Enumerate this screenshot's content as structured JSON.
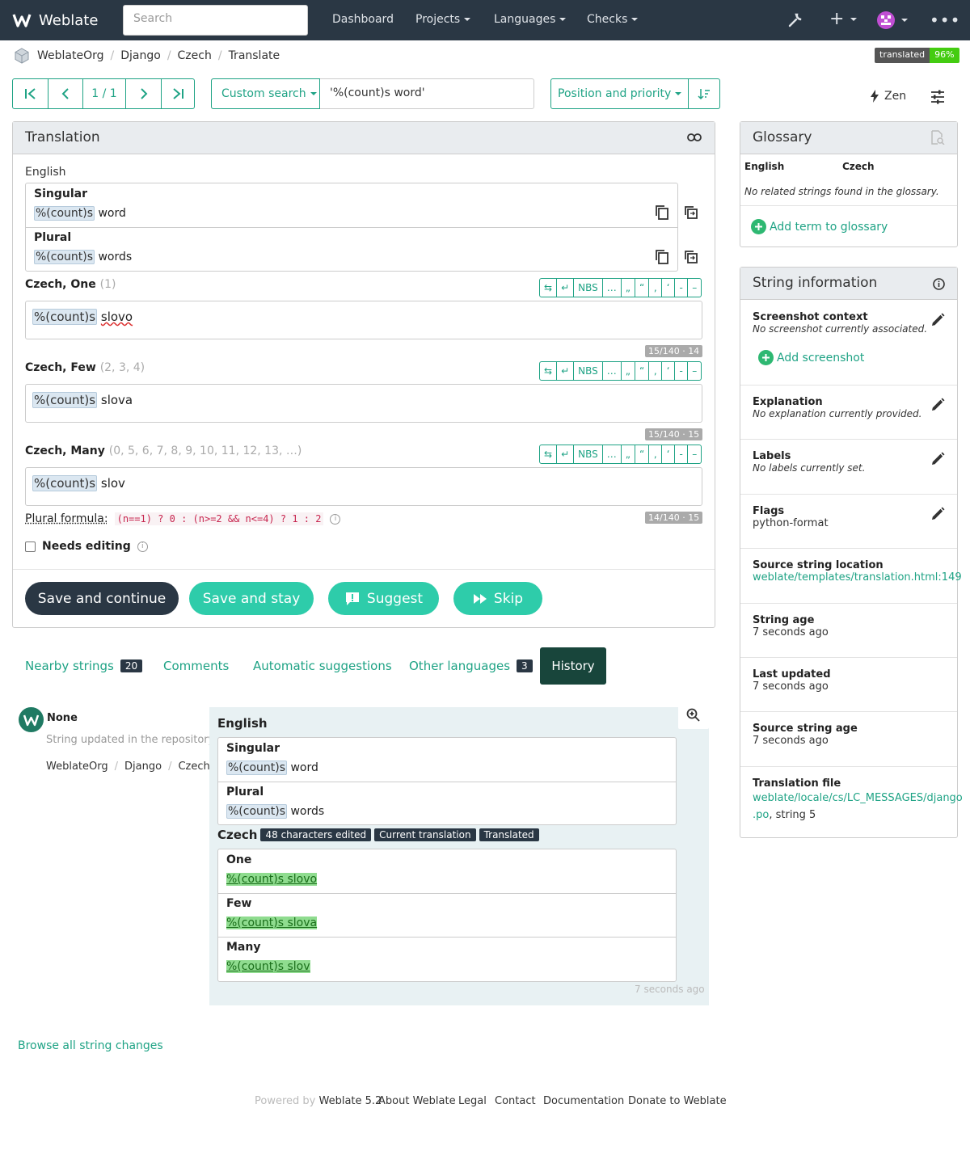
{
  "navbar": {
    "brand": "Weblate",
    "search_placeholder": "Search",
    "links": [
      "Dashboard",
      "Projects",
      "Languages",
      "Checks"
    ]
  },
  "breadcrumb": [
    "WeblateOrg",
    "Django",
    "Czech",
    "Translate"
  ],
  "translated_badge": {
    "label": "translated",
    "value": "96%"
  },
  "toolbar": {
    "position": "1 / 1",
    "search_type": "Custom search",
    "query": "'%(count)s word'",
    "sort": "Position and priority",
    "zen": "Zen"
  },
  "translation": {
    "title": "Translation",
    "source_lang": "English",
    "singular_label": "Singular",
    "singular_text": "word",
    "plural_label": "Plural",
    "plural_text": "words",
    "placeholder": "%(count)s",
    "forms": [
      {
        "name": "Czech, One",
        "nums": "(1)",
        "text": "slovo",
        "counter": "15/140 · 14"
      },
      {
        "name": "Czech, Few",
        "nums": "(2, 3, 4)",
        "text": "slova",
        "counter": "15/140 · 15"
      },
      {
        "name": "Czech, Many",
        "nums": "(0, 5, 6, 7, 8, 9, 10, 11, 12, 13, …)",
        "text": "slov",
        "counter": "14/140 · 15"
      }
    ],
    "charbar": [
      "↵",
      "NBS",
      "…",
      "„",
      "“",
      "‚",
      "‘",
      "-",
      "–"
    ],
    "plural_formula_label": "Plural formula:",
    "plural_formula": "(n==1) ? 0 : (n>=2 && n<=4) ? 1 : 2",
    "needs_editing": "Needs editing",
    "buttons": {
      "save_continue": "Save and continue",
      "save_stay": "Save and stay",
      "suggest": "Suggest",
      "skip": "Skip"
    }
  },
  "tabs": [
    {
      "label": "Nearby strings",
      "count": "20"
    },
    {
      "label": "Comments"
    },
    {
      "label": "Automatic suggestions"
    },
    {
      "label": "Other languages",
      "count": "3"
    },
    {
      "label": "History"
    }
  ],
  "history": {
    "user": "None",
    "action": "String updated in the repository",
    "path": [
      "WeblateOrg",
      "Django",
      "Czech"
    ],
    "english": "English",
    "singular": "Singular",
    "singular_text": "word",
    "plural": "Plural",
    "plural_text": "words",
    "placeholder": "%(count)s",
    "czech": "Czech",
    "tags": [
      "48 characters edited",
      "Current translation",
      "Translated"
    ],
    "forms": [
      {
        "label": "One",
        "text": "%(count)s slovo"
      },
      {
        "label": "Few",
        "text": "%(count)s slova"
      },
      {
        "label": "Many",
        "text": "%(count)s slov"
      }
    ],
    "age": "7 seconds ago"
  },
  "browse_changes": "Browse all string changes",
  "glossary": {
    "title": "Glossary",
    "col_source": "English",
    "col_target": "Czech",
    "empty": "No related strings found in the glossary.",
    "add": "Add term to glossary"
  },
  "string_info": {
    "title": "String information",
    "screenshot_title": "Screenshot context",
    "screenshot_value": "No screenshot currently associated.",
    "add_screenshot": "Add screenshot",
    "explanation_title": "Explanation",
    "explanation_value": "No explanation currently provided.",
    "labels_title": "Labels",
    "labels_value": "No labels currently set.",
    "flags_title": "Flags",
    "flags_value": "python-format",
    "location_title": "Source string location",
    "location_value": "weblate/templates/translation.html:149",
    "age_title": "String age",
    "age_value": "7 seconds ago",
    "updated_title": "Last updated",
    "updated_value": "7 seconds ago",
    "source_age_title": "Source string age",
    "source_age_value": "7 seconds ago",
    "file_title": "Translation file",
    "file_line1": "weblate/locale/cs/LC_MESSAGES/django",
    "file_line2": ".po",
    "file_suffix": ", string 5"
  },
  "footer": {
    "powered": "Powered by",
    "version": "Weblate 5.2",
    "links": [
      "About Weblate",
      "Legal",
      "Contact",
      "Documentation",
      "Donate to Weblate"
    ]
  },
  "colors": {
    "navbar": "#2a3744",
    "accent": "#1fa385",
    "button_teal": "#2eccaa",
    "dark": "#2a3744"
  }
}
